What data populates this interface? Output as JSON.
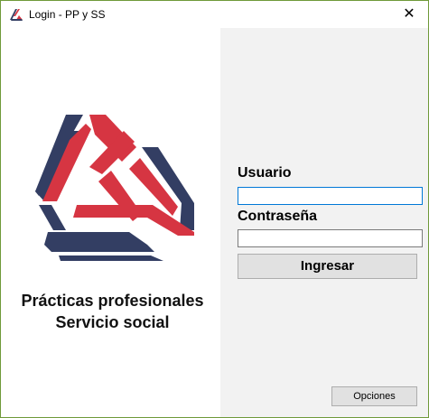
{
  "window": {
    "title": "Login - PP y SS",
    "close_glyph": "✕",
    "icon": "app-logo-icon",
    "border_color": "#6f9a3a"
  },
  "branding": {
    "line1": "Prácticas profesionales",
    "line2": "Servicio social",
    "colors": {
      "red": "#d63542",
      "navy": "#333e63"
    }
  },
  "form": {
    "user_label": "Usuario",
    "user_value": "",
    "password_label": "Contraseña",
    "password_value": "",
    "submit_label": "Ingresar",
    "focus_color": "#0078d7"
  },
  "footer": {
    "options_label": "Opciones"
  }
}
